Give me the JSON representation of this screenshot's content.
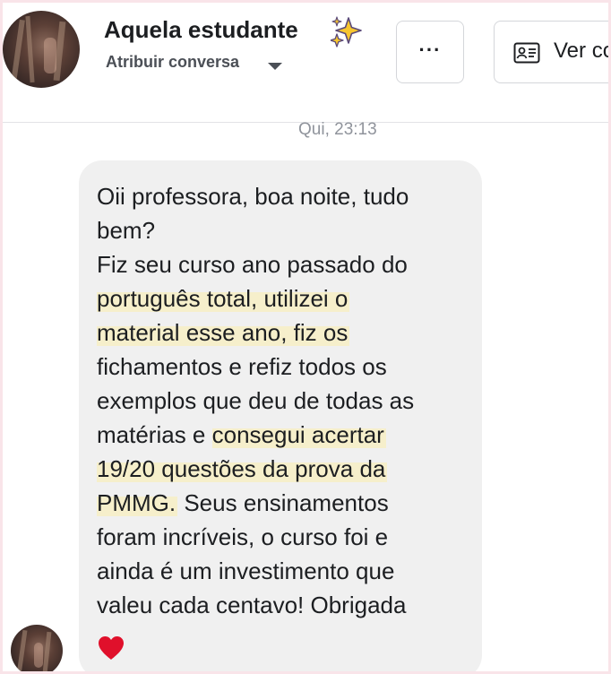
{
  "header": {
    "contact_name": "Aquela estudante",
    "assign_label": "Atribuir conversa",
    "more_label": "···",
    "profile_label": "Ver co"
  },
  "icons": {
    "sparkle": "sparkles-emoji-icon",
    "caret": "caret-down-icon",
    "card": "contact-card-icon",
    "heart": "red-heart-emoji-icon"
  },
  "colors": {
    "highlight": "#f6efcb",
    "bubble": "#f0f0f0",
    "heart": "#e0102b",
    "frame": "#f9e4e9"
  },
  "conversation": {
    "timestamp": "Qui, 23:13",
    "message": {
      "lines": [
        [
          {
            "text": "Oii professora, boa noite, tudo",
            "hl": false
          }
        ],
        [
          {
            "text": "bem?",
            "hl": false
          }
        ],
        [
          {
            "text": "Fiz seu curso ano passado do",
            "hl": false
          }
        ],
        [
          {
            "text": "português total, utilizei o",
            "hl": true
          }
        ],
        [
          {
            "text": "material esse ano, fiz os",
            "hl": true
          }
        ],
        [
          {
            "text": "fichamentos e refiz todos os",
            "hl": false
          }
        ],
        [
          {
            "text": "exemplos que deu de todas as",
            "hl": false
          }
        ],
        [
          {
            "text": "matérias e ",
            "hl": false
          },
          {
            "text": "consegui acertar",
            "hl": true
          }
        ],
        [
          {
            "text": "19/20 questões da prova da",
            "hl": true
          }
        ],
        [
          {
            "text": "PMMG.",
            "hl": true
          },
          {
            "text": " Seus ensinamentos",
            "hl": false
          }
        ],
        [
          {
            "text": "foram incríveis, o curso foi e",
            "hl": false
          }
        ],
        [
          {
            "text": "ainda é um investimento que",
            "hl": false
          }
        ],
        [
          {
            "text": "valeu cada centavo! Obrigada",
            "hl": false
          }
        ]
      ]
    }
  }
}
